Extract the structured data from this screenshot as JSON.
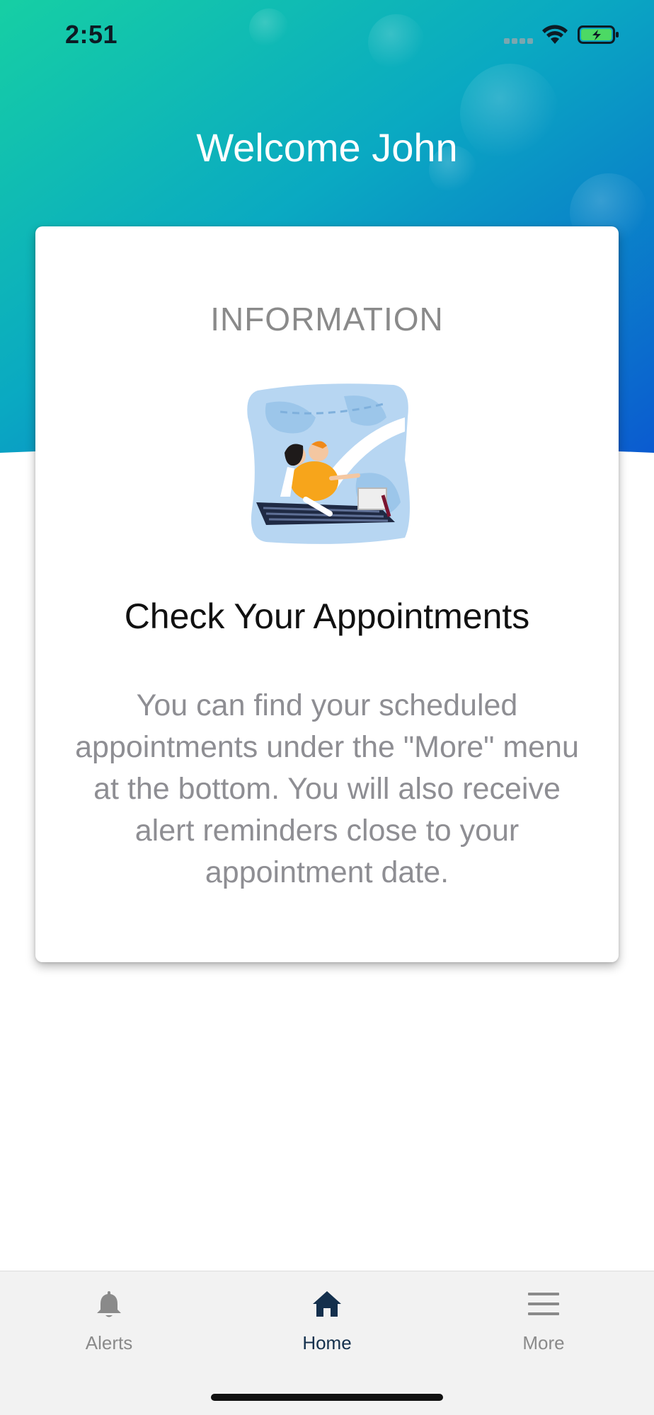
{
  "status_bar": {
    "time": "2:51",
    "battery_color": "#4cd964"
  },
  "header": {
    "title": "Welcome John",
    "gradient": [
      "#13c9a8",
      "#0aa6c4",
      "#0a5fcf"
    ]
  },
  "card": {
    "eyebrow": "INFORMATION",
    "heading": "Check Your Appointments",
    "body": "You can find your scheduled appointments under the \"More\" menu at the bottom. You will also receive alert reminders close to your appointment date.",
    "illustration": "travel-illustration"
  },
  "tab_bar": {
    "tabs": [
      {
        "label": "Alerts",
        "icon": "bell-icon",
        "active": false
      },
      {
        "label": "Home",
        "icon": "home-icon",
        "active": true
      },
      {
        "label": "More",
        "icon": "menu-icon",
        "active": false
      }
    ],
    "active_color": "#14304d",
    "inactive_color": "#8a8a8a"
  }
}
